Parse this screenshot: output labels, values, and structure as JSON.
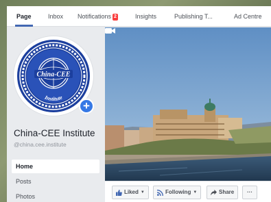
{
  "nav": {
    "tabs": [
      {
        "label": "Page"
      },
      {
        "label": "Inbox"
      },
      {
        "label": "Notifications",
        "badge": "2"
      },
      {
        "label": "Insights"
      },
      {
        "label": "Publishing T..."
      },
      {
        "label": "Ad Centre"
      }
    ]
  },
  "profile": {
    "name": "China-CEE Institute",
    "handle": "@china.cee.institute",
    "logo_text_top": "China-CEE",
    "logo_text_bottom": "Institute"
  },
  "sidebar": {
    "items": [
      {
        "label": "Home",
        "active": true
      },
      {
        "label": "Posts"
      },
      {
        "label": "Photos"
      }
    ]
  },
  "actions": {
    "liked": "Liked",
    "following": "Following",
    "share": "Share",
    "more": "···"
  },
  "colors": {
    "accent": "#4267b2",
    "badge": "#fa3e3e",
    "logo_blue": "#1c3f9e",
    "plus_blue": "#3578e5"
  },
  "icons": {
    "video": "video-camera-icon",
    "like": "thumbs-up-icon",
    "following": "rss-icon",
    "share": "share-arrow-icon",
    "add": "plus-icon"
  }
}
